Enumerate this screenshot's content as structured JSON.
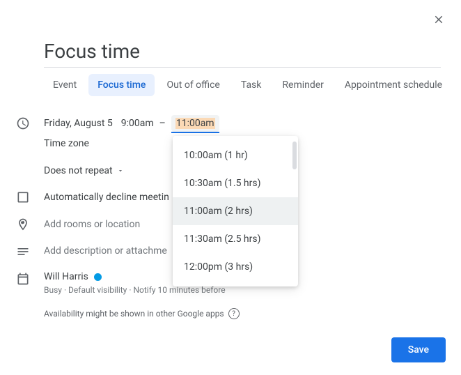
{
  "title": "Focus time",
  "tabs": [
    "Event",
    "Focus time",
    "Out of office",
    "Task",
    "Reminder",
    "Appointment schedule"
  ],
  "active_tab": 1,
  "date": "Friday, August 5",
  "start_time": "9:00am",
  "end_time": "11:00am",
  "timezone_label": "Time zone",
  "repeat_label": "Does not repeat",
  "auto_decline_label": "Automatically decline meetin",
  "location_placeholder": "Add rooms or location",
  "description_placeholder": "Add description or attachme",
  "user_name": "Will Harris",
  "user_sub": "Busy · Default visibility · Notify 10 minutes before",
  "availability_note": "Availability might be shown in other Google apps",
  "save_label": "Save",
  "end_time_options": [
    "10:00am (1 hr)",
    "10:30am (1.5 hrs)",
    "11:00am (2 hrs)",
    "11:30am (2.5 hrs)",
    "12:00pm (3 hrs)"
  ],
  "selected_end_option": 2
}
